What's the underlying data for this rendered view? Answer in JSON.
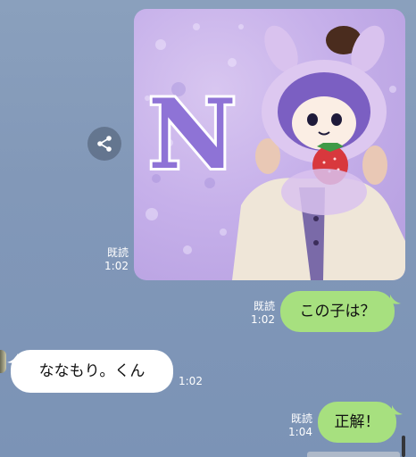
{
  "messages": {
    "image": {
      "read_label": "既読",
      "time": "1:02",
      "image_letter": "N"
    },
    "question": {
      "text": "この子は？",
      "read_label": "既読",
      "time": "1:02"
    },
    "answer": {
      "text": "ななもり。くん",
      "time": "1:02"
    },
    "reply": {
      "text": "正解！",
      "read_label": "既読",
      "time": "1:04"
    }
  },
  "icons": {
    "share": "share-icon"
  },
  "colors": {
    "background": "#8298b8",
    "outgoing_bubble": "#a7e07f",
    "incoming_bubble": "#ffffff"
  }
}
